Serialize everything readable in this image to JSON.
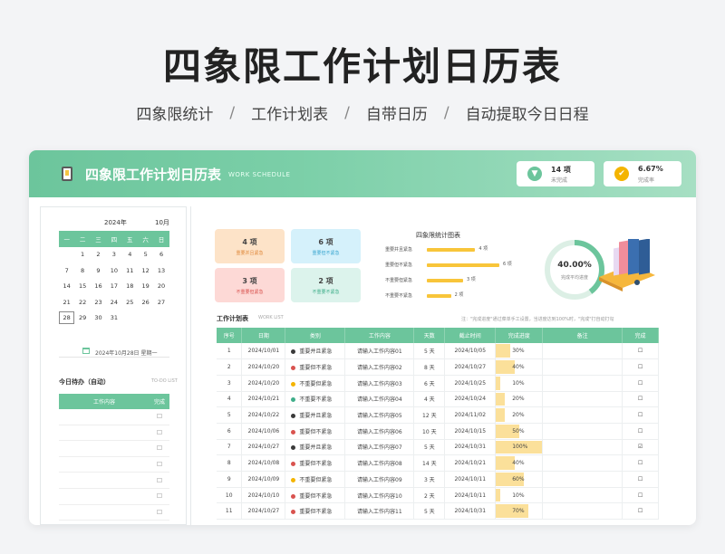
{
  "hero": {
    "title": "四象限工作计划日历表",
    "features": [
      "四象限统计",
      "工作计划表",
      "自带日历",
      "自动提取今日日程"
    ],
    "separator": "/"
  },
  "header": {
    "title": "四象限工作计划日历表",
    "subtitle": "WORK SCHEDULE",
    "stats": [
      {
        "value": "14 项",
        "label": "未完成",
        "icon": "funnel-icon",
        "color": "#6cc59c"
      },
      {
        "value": "6.67%",
        "label": "完成率",
        "icon": "check-circle-icon",
        "color": "#f4b400"
      }
    ]
  },
  "calendar": {
    "year": "2024年",
    "month": "10月",
    "weekdays": [
      "一",
      "二",
      "三",
      "四",
      "五",
      "六",
      "日"
    ],
    "weeks": [
      [
        "",
        "1",
        "2",
        "3",
        "4",
        "5",
        "6"
      ],
      [
        "7",
        "8",
        "9",
        "10",
        "11",
        "12",
        "13"
      ],
      [
        "14",
        "15",
        "16",
        "17",
        "18",
        "19",
        "20"
      ],
      [
        "21",
        "22",
        "23",
        "24",
        "25",
        "26",
        "27"
      ],
      [
        "28",
        "29",
        "30",
        "31",
        "",
        "",
        ""
      ]
    ],
    "today": "28",
    "date_text": "2024年10月28日 星期一"
  },
  "todo": {
    "title": "今日待办（自动）",
    "title_en": "TO-DO LIST",
    "col_content": "工作内容",
    "col_done": "完成",
    "rows": [
      "☐",
      "☐",
      "☐",
      "☐",
      "☐",
      "☐",
      "☐",
      "☐"
    ]
  },
  "quadrants": [
    {
      "count": "4 项",
      "label": "重要并且紧急",
      "bg": "#fde3c8",
      "fg": "#e08a3c"
    },
    {
      "count": "6 项",
      "label": "重要但不紧急",
      "bg": "#d5f1fb",
      "fg": "#3aa6d0"
    },
    {
      "count": "3 项",
      "label": "不重要但紧急",
      "bg": "#fdd9d6",
      "fg": "#d9534f"
    },
    {
      "count": "2 项",
      "label": "不重要不紧急",
      "bg": "#dcf3ec",
      "fg": "#3fae8a"
    }
  ],
  "chart_data": {
    "type": "bar",
    "title": "四象限统计图表",
    "categories": [
      "重要并且紧急",
      "重要但不紧急",
      "不重要但紧急",
      "不重要不紧急"
    ],
    "values": [
      4,
      6,
      3,
      2
    ],
    "value_labels": [
      "4 项",
      "6 项",
      "3 项",
      "2 项"
    ],
    "color": "#f8c53a"
  },
  "progress_donut": {
    "value": 0.4,
    "percent_text": "40.00%",
    "label": "完成平均进度",
    "color": "#6cc59c",
    "track": "#dcefe5"
  },
  "plan": {
    "title": "工作计划表",
    "title_en": "WORK LIST",
    "note": "注：\"完成进度\"通过菜单手工设置，当进度达到100%时，\"完成\"打自动打勾",
    "headers": [
      "序号",
      "日期",
      "类别",
      "工作内容",
      "天数",
      "截止时间",
      "完成进度",
      "备注",
      "完成"
    ],
    "type_colors": {
      "重要并且紧急": "#3a3a3a",
      "重要但不紧急": "#d9534f",
      "不重要但紧急": "#f4b400",
      "不重要不紧急": "#3fae8a"
    },
    "rows": [
      {
        "no": "1",
        "date": "2024/10/01",
        "type": "重要并且紧急",
        "content": "请输入工作内容01",
        "days": "5 天",
        "due": "2024/10/05",
        "progress": 0.3,
        "progress_text": "30%",
        "note": "",
        "done": "☐"
      },
      {
        "no": "2",
        "date": "2024/10/20",
        "type": "重要但不紧急",
        "content": "请输入工作内容02",
        "days": "8 天",
        "due": "2024/10/27",
        "progress": 0.4,
        "progress_text": "40%",
        "note": "",
        "done": "☐"
      },
      {
        "no": "3",
        "date": "2024/10/20",
        "type": "不重要但紧急",
        "content": "请输入工作内容03",
        "days": "6 天",
        "due": "2024/10/25",
        "progress": 0.1,
        "progress_text": "10%",
        "note": "",
        "done": "☐"
      },
      {
        "no": "4",
        "date": "2024/10/21",
        "type": "不重要不紧急",
        "content": "请输入工作内容04",
        "days": "4 天",
        "due": "2024/10/24",
        "progress": 0.2,
        "progress_text": "20%",
        "note": "",
        "done": "☐"
      },
      {
        "no": "5",
        "date": "2024/10/22",
        "type": "重要并且紧急",
        "content": "请输入工作内容05",
        "days": "12 天",
        "due": "2024/11/02",
        "progress": 0.2,
        "progress_text": "20%",
        "note": "",
        "done": "☐"
      },
      {
        "no": "6",
        "date": "2024/10/06",
        "type": "重要但不紧急",
        "content": "请输入工作内容06",
        "days": "10 天",
        "due": "2024/10/15",
        "progress": 0.5,
        "progress_text": "50%",
        "note": "",
        "done": "☐"
      },
      {
        "no": "7",
        "date": "2024/10/27",
        "type": "重要并且紧急",
        "content": "请输入工作内容07",
        "days": "5 天",
        "due": "2024/10/31",
        "progress": 1.0,
        "progress_text": "100%",
        "note": "",
        "done": "☑"
      },
      {
        "no": "8",
        "date": "2024/10/08",
        "type": "重要但不紧急",
        "content": "请输入工作内容08",
        "days": "14 天",
        "due": "2024/10/21",
        "progress": 0.4,
        "progress_text": "40%",
        "note": "",
        "done": "☐"
      },
      {
        "no": "9",
        "date": "2024/10/09",
        "type": "不重要但紧急",
        "content": "请输入工作内容09",
        "days": "3 天",
        "due": "2024/10/11",
        "progress": 0.6,
        "progress_text": "60%",
        "note": "",
        "done": "☐"
      },
      {
        "no": "10",
        "date": "2024/10/10",
        "type": "重要但不紧急",
        "content": "请输入工作内容10",
        "days": "2 天",
        "due": "2024/10/11",
        "progress": 0.1,
        "progress_text": "10%",
        "note": "",
        "done": "☐"
      },
      {
        "no": "11",
        "date": "2024/10/27",
        "type": "重要但不紧急",
        "content": "请输入工作内容11",
        "days": "5 天",
        "due": "2024/10/31",
        "progress": 0.7,
        "progress_text": "70%",
        "note": "",
        "done": "☐"
      }
    ]
  }
}
